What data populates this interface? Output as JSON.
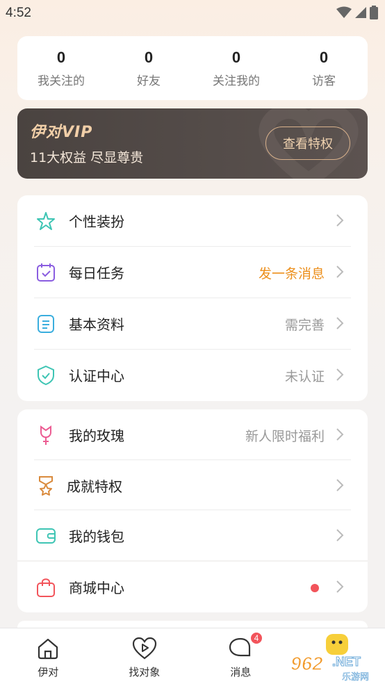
{
  "status_bar": {
    "time": "4:52"
  },
  "stats": [
    {
      "value": "0",
      "label": "我关注的"
    },
    {
      "value": "0",
      "label": "好友"
    },
    {
      "value": "0",
      "label": "关注我的"
    },
    {
      "value": "0",
      "label": "访客"
    }
  ],
  "vip": {
    "title": "伊对VIP",
    "subtitle": "11大权益 尽显尊贵",
    "button": "查看特权"
  },
  "menu_group1": [
    {
      "label": "个性装扮",
      "value": "",
      "icon": "star-sparkle-icon"
    },
    {
      "label": "每日任务",
      "value": "发一条消息",
      "icon": "calendar-check-icon",
      "value_color": "#ec8f1c"
    },
    {
      "label": "基本资料",
      "value": "需完善",
      "icon": "document-icon"
    },
    {
      "label": "认证中心",
      "value": "未认证",
      "icon": "shield-check-icon"
    }
  ],
  "menu_group2": [
    {
      "label": "我的玫瑰",
      "value": "新人限时福利",
      "icon": "rose-icon"
    },
    {
      "label": "成就特权",
      "value": "",
      "icon": "medal-icon"
    },
    {
      "label": "我的钱包",
      "value": "",
      "icon": "wallet-icon"
    },
    {
      "label": "商城中心",
      "value": "",
      "icon": "shopping-bag-icon",
      "has_dot": true
    }
  ],
  "tabbar": [
    {
      "label": "伊对",
      "icon": "home-icon"
    },
    {
      "label": "找对象",
      "icon": "heart-play-icon"
    },
    {
      "label": "消息",
      "icon": "chat-bubble-icon",
      "badge": "4"
    },
    {
      "label": "",
      "icon": "face-icon"
    }
  ],
  "watermark": {
    "text1": "962",
    "text2": ".NET",
    "text3": "乐游网"
  },
  "colors": {
    "accent_orange": "#ec8f1c",
    "vip_gold": "#f1cfa8",
    "badge_red": "#f2545b",
    "teal": "#3ec5b4",
    "purple": "#8a5de0",
    "blue": "#3aaede",
    "pink": "#ec5d93",
    "brown": "#d98a3c"
  }
}
